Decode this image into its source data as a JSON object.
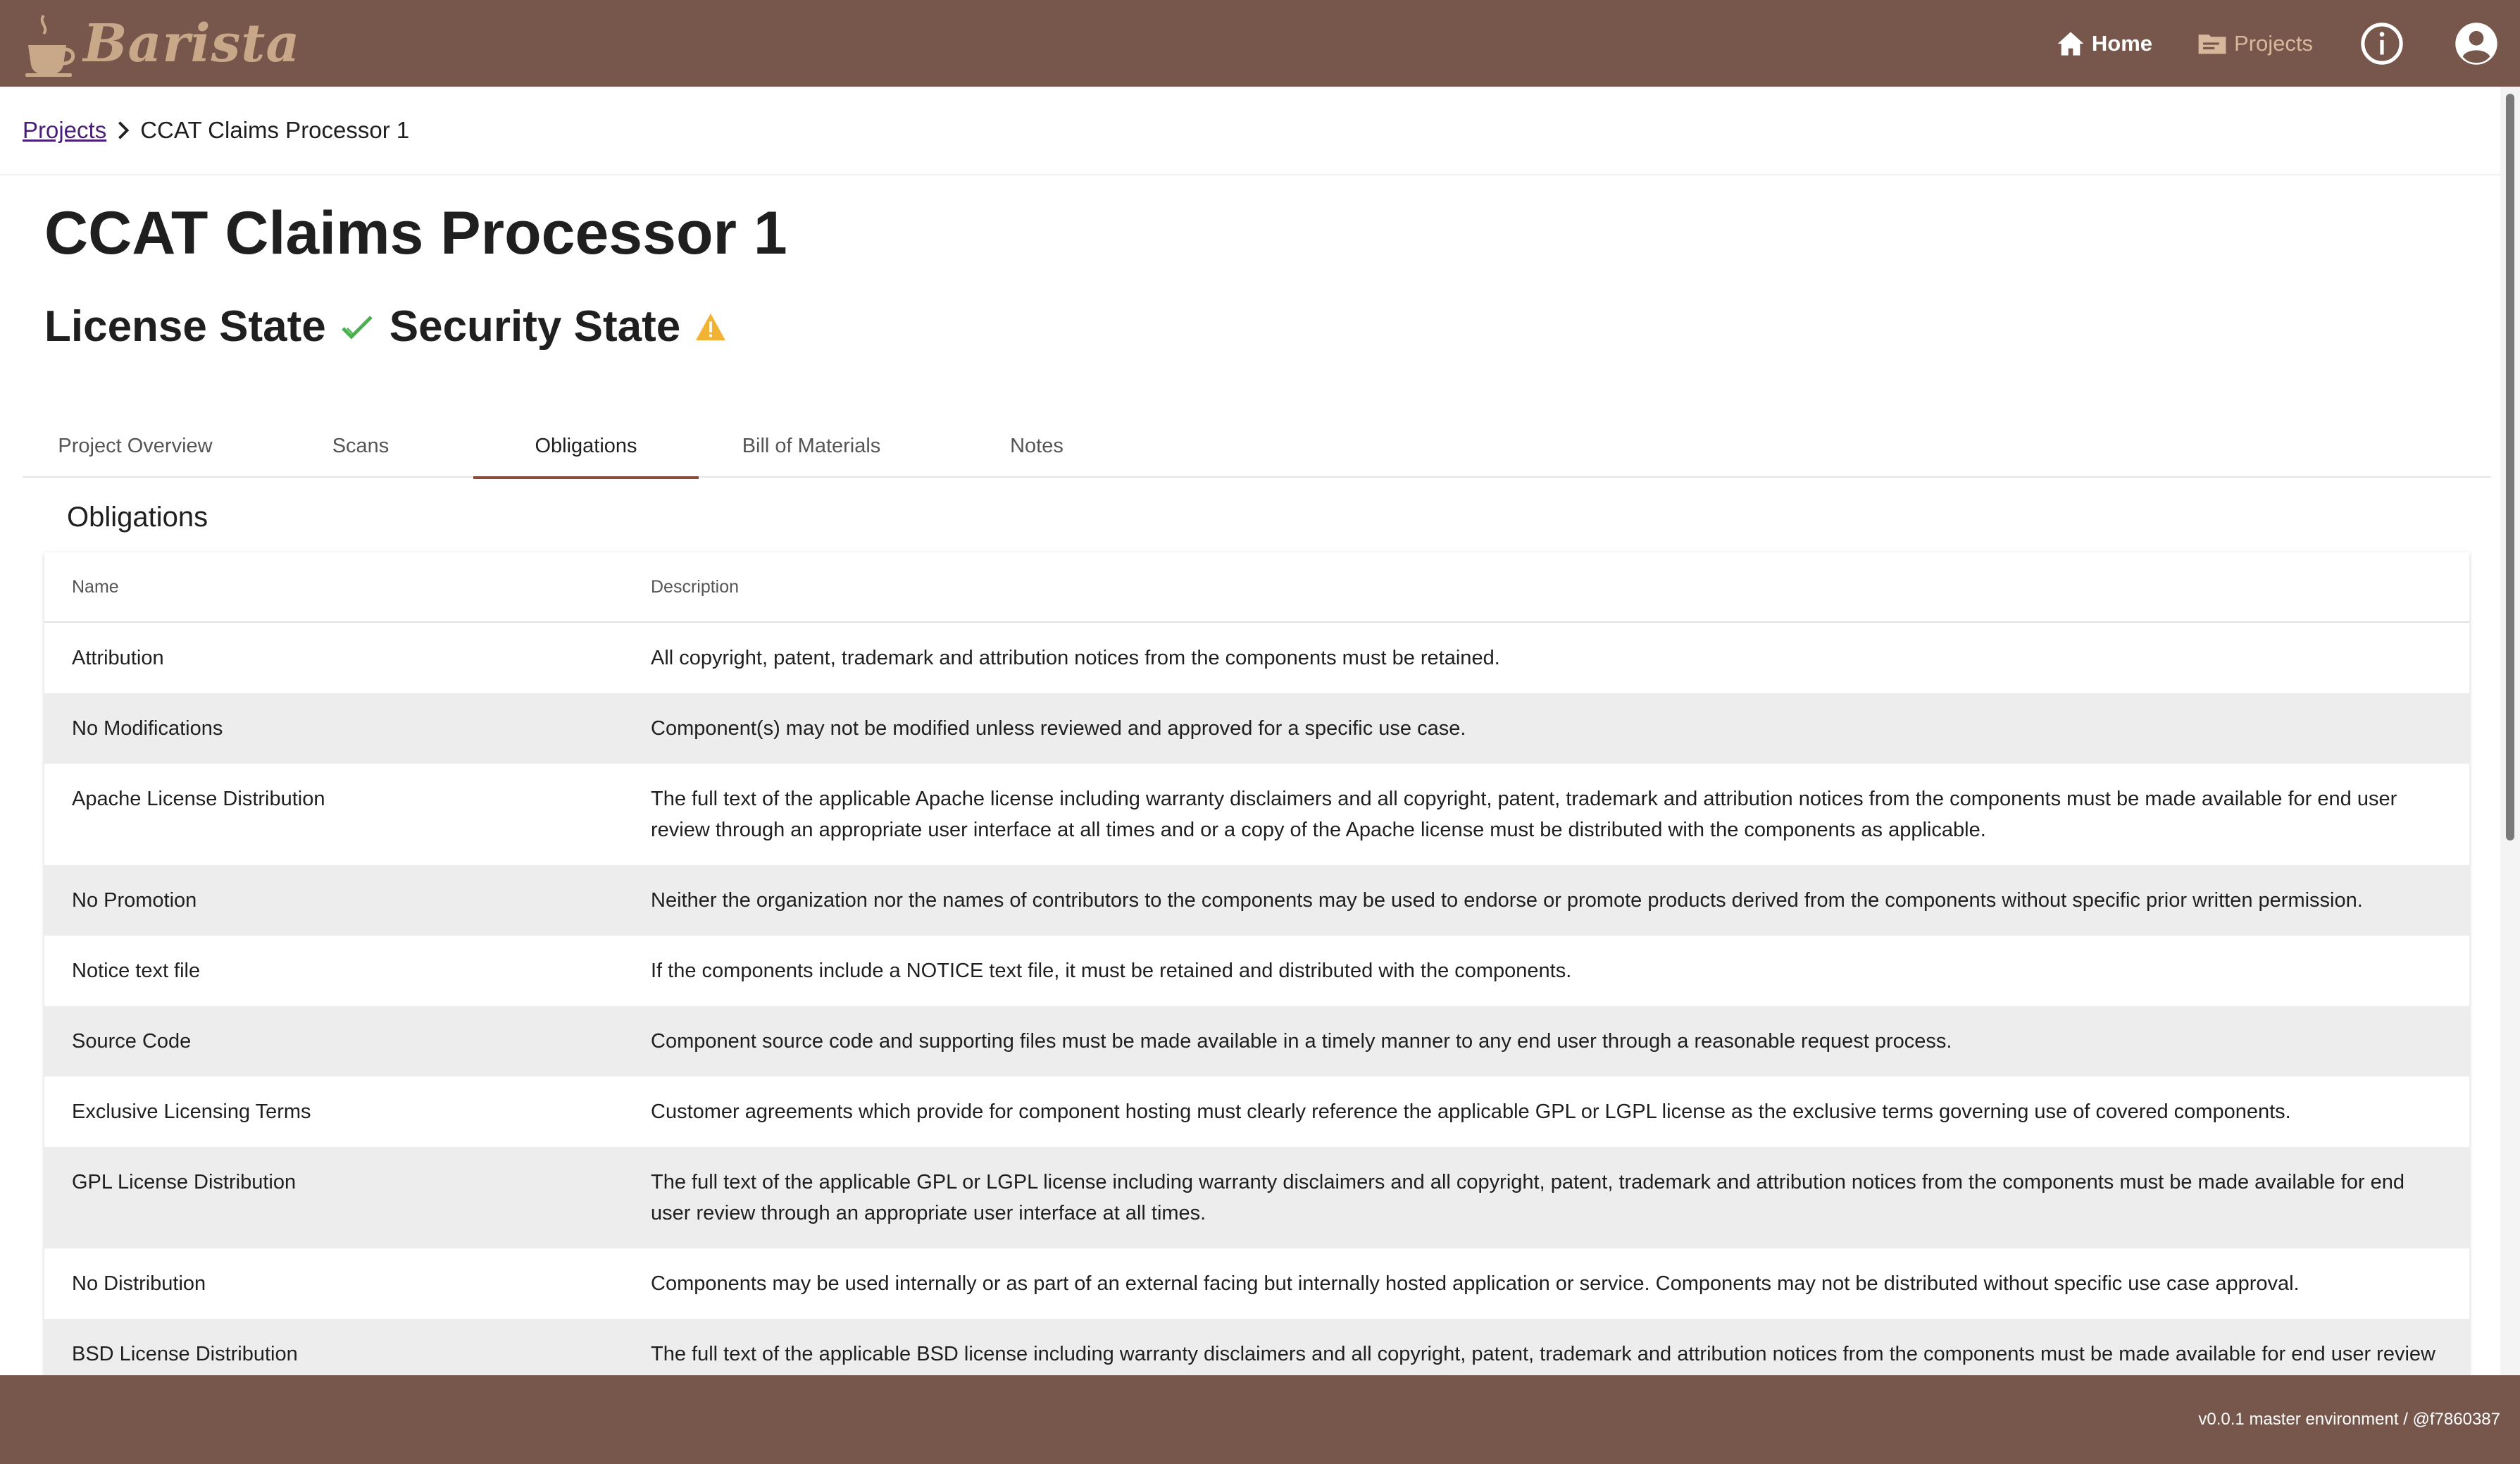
{
  "header": {
    "app_name": "Barista",
    "nav": {
      "home": "Home",
      "projects": "Projects"
    },
    "icons": {
      "home": "home-icon",
      "projects": "folder-icon",
      "info": "info-icon",
      "account": "account-icon"
    },
    "colors": {
      "bar": "#77574b",
      "logo": "#c9a889",
      "active_nav": "#d7b89d"
    }
  },
  "breadcrumb": {
    "parent": "Projects",
    "current": "CCAT Claims Processor 1"
  },
  "project": {
    "title": "CCAT Claims Processor 1",
    "license_state_label": "License State",
    "security_state_label": "Security State",
    "license_state_icon": "check-icon",
    "security_state_icon": "warning-icon"
  },
  "tabs": [
    {
      "label": "Project Overview",
      "active": false
    },
    {
      "label": "Scans",
      "active": false
    },
    {
      "label": "Obligations",
      "active": true
    },
    {
      "label": "Bill of Materials",
      "active": false
    },
    {
      "label": "Notes",
      "active": false
    }
  ],
  "obligations": {
    "section_title": "Obligations",
    "columns": {
      "name": "Name",
      "description": "Description"
    },
    "rows": [
      {
        "name": "Attribution",
        "description": "All copyright, patent, trademark and attribution notices from the components must be retained."
      },
      {
        "name": "No Modifications",
        "description": "Component(s) may not be modified unless reviewed and approved for a specific use case."
      },
      {
        "name": "Apache License Distribution",
        "description": "The full text of the applicable Apache license including warranty disclaimers and all copyright, patent, trademark and attribution notices from the components must be made available for end user review through an appropriate user interface at all times and or a copy of the Apache license must be distributed with the components as applicable."
      },
      {
        "name": "No Promotion",
        "description": "Neither the organization nor the names of contributors to the components may be used to endorse or promote products derived from the components without specific prior written permission."
      },
      {
        "name": "Notice text file",
        "description": "If the components include a NOTICE text file, it must be retained and distributed with the components."
      },
      {
        "name": "Source Code",
        "description": "Component source code and supporting files must be made available in a timely manner to any end user through a reasonable request process."
      },
      {
        "name": "Exclusive Licensing Terms",
        "description": "Customer agreements which provide for component hosting must clearly reference the applicable GPL or LGPL license as the exclusive terms governing use of covered components."
      },
      {
        "name": "GPL License Distribution",
        "description": "The full text of the applicable GPL or LGPL license including warranty disclaimers and all copyright, patent, trademark and attribution notices from the components must be made available for end user review through an appropriate user interface at all times."
      },
      {
        "name": "No Distribution",
        "description": "Components may be used internally or as part of an external facing but internally hosted application or service. Components may not be distributed without specific use case approval."
      },
      {
        "name": "BSD License Distribution",
        "description": "The full text of the applicable BSD license including warranty disclaimers and all copyright, patent, trademark and attribution notices from the components must be made available for end user review"
      }
    ]
  },
  "footer": {
    "version": "v0.0.1 master environment / @f7860387"
  }
}
